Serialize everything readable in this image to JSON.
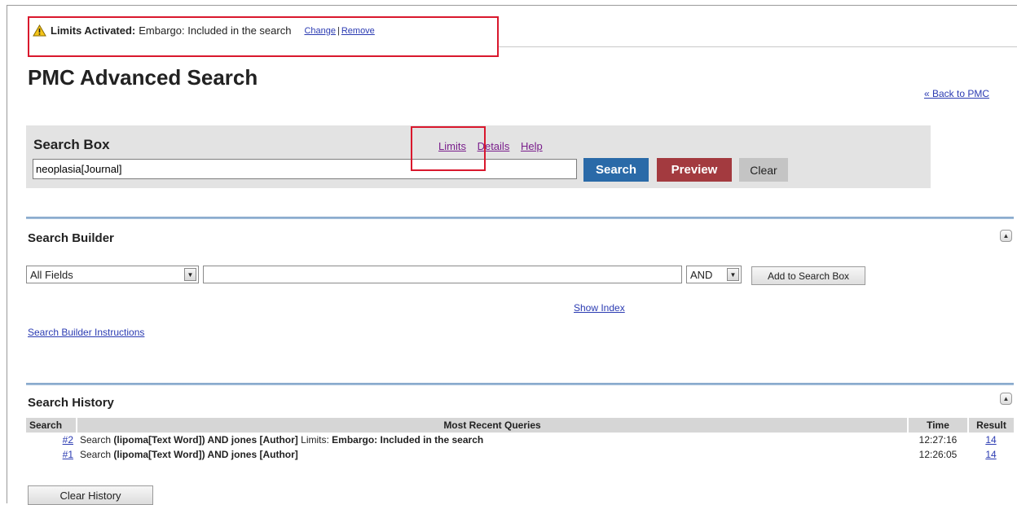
{
  "limits_bar": {
    "label": "Limits Activated:",
    "value": "Embargo: Included in the search",
    "change_link": "Change",
    "separator": "|",
    "remove_link": "Remove",
    "accent_color": "#d9182d"
  },
  "page": {
    "title": "PMC Advanced Search",
    "back_link": "« Back to PMC"
  },
  "search_box": {
    "label": "Search Box",
    "value": "neoplasia[Journal]",
    "links": {
      "limits": "Limits",
      "details": "Details",
      "help": "Help"
    },
    "search_button": "Search",
    "preview_button": "Preview",
    "clear_button": "Clear",
    "colors": {
      "search": "#2a6aa8",
      "preview": "#a33a3f",
      "clear": "#c4c4c4"
    }
  },
  "search_builder": {
    "title": "Search Builder",
    "field_select": "All Fields",
    "term_value": "",
    "bool_select": "AND",
    "add_button": "Add to Search Box",
    "show_index": "Show Index",
    "instructions_link": "Search Builder Instructions"
  },
  "search_history": {
    "title": "Search History",
    "columns": {
      "search": "Search",
      "query": "Most Recent Queries",
      "time": "Time",
      "result": "Result"
    },
    "rows": [
      {
        "num": "#2",
        "prefix": "Search",
        "query": "(lipoma[Text Word]) AND jones [Author]",
        "limits_label": "Limits:",
        "limits_value": "Embargo: Included in the search",
        "time": "12:27:16",
        "result": "14"
      },
      {
        "num": "#1",
        "prefix": "Search",
        "query": "(lipoma[Text Word]) AND jones [Author]",
        "limits_label": "",
        "limits_value": "",
        "time": "12:26:05",
        "result": "14"
      }
    ],
    "clear_button": "Clear History"
  },
  "icons": {
    "warning": "warning-icon",
    "collapse": "collapse-up-icon",
    "dropdown": "chevron-down-icon"
  }
}
